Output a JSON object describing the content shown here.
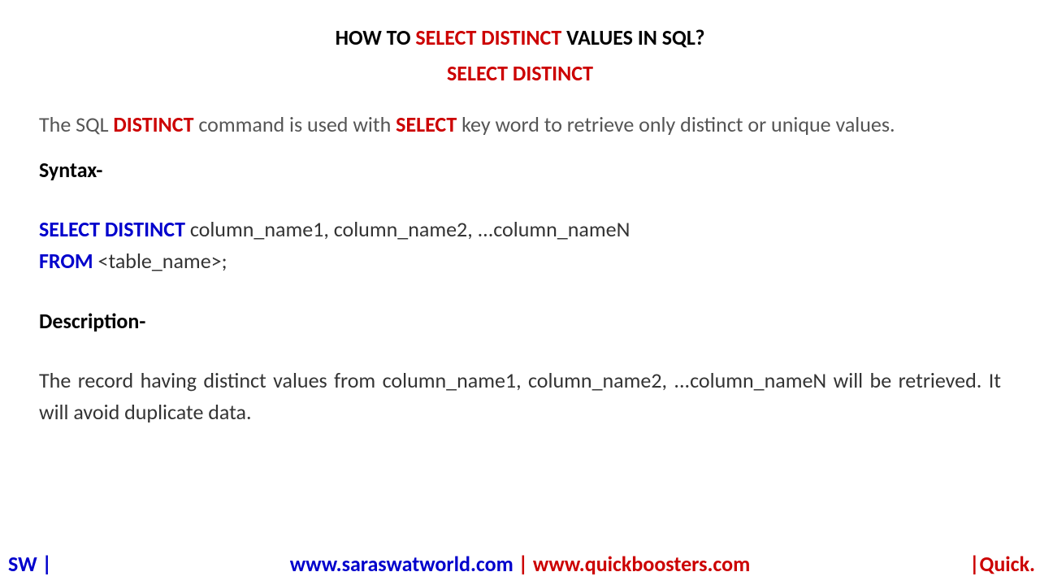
{
  "title": {
    "pre": "HOW TO ",
    "highlight": "SELECT DISTINCT",
    "post": " VALUES IN SQL?"
  },
  "subtitle": "SELECT DISTINCT",
  "intro": {
    "part1": "The SQL ",
    "kw1": "DISTINCT",
    "part2": " command is used with ",
    "kw2": "SELECT",
    "part3": " key word to retrieve only distinct or unique values."
  },
  "syntax_label": "Syntax-",
  "syntax": {
    "line1_kw": "SELECT DISTINCT",
    "line1_rest": " column_name1, column_name2, ...column_nameN",
    "line2_kw": "FROM",
    "line2_rest": " <table_name>;"
  },
  "description_label": "Description-",
  "description": "The record having distinct values from column_name1, column_name2, ...column_nameN will be retrieved. It will avoid duplicate data.",
  "footer": {
    "left": "SW |",
    "url1": "www.saraswatworld.com",
    "sep": " | ",
    "url2": "www.quickboosters.com",
    "right": "|Quick."
  }
}
